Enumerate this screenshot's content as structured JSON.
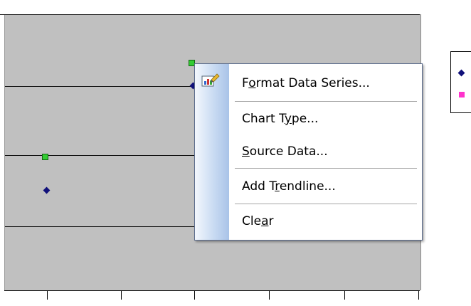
{
  "menu": {
    "items": [
      {
        "pre": "F",
        "ul": "o",
        "post": "rmat Data Series..."
      },
      {
        "pre": "Chart T",
        "ul": "y",
        "post": "pe..."
      },
      {
        "pre": "",
        "ul": "S",
        "post": "ource Data..."
      },
      {
        "pre": "Add T",
        "ul": "r",
        "post": "endline..."
      },
      {
        "pre": "Cle",
        "ul": "a",
        "post": "r"
      }
    ],
    "format_icon": "format-chart-icon"
  },
  "chart": {
    "plot_bg": "#c0c0c0",
    "series_colors": [
      "#10107a",
      "#ff33cc",
      "#33cc33"
    ],
    "selected_series_marker": "green-square"
  },
  "legend": {
    "entries": [
      {
        "marker": "navy-diamond"
      },
      {
        "marker": "magenta-square"
      }
    ]
  }
}
